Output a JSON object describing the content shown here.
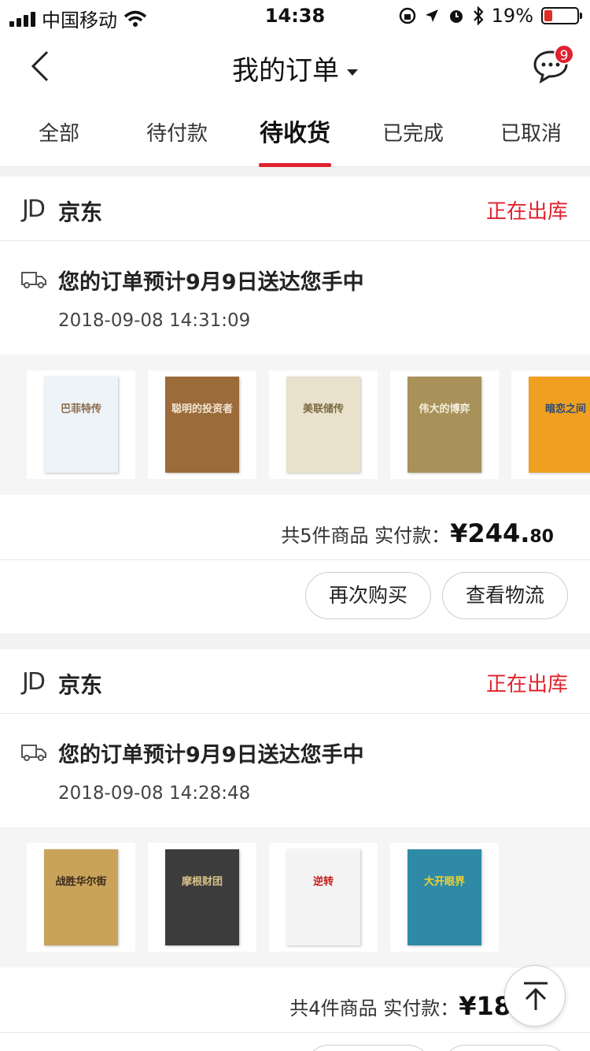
{
  "status_bar": {
    "carrier": "中国移动",
    "time": "14:38",
    "battery": "19%"
  },
  "nav": {
    "title": "我的订单",
    "message_badge": "9"
  },
  "tabs": [
    {
      "label": "全部"
    },
    {
      "label": "待付款"
    },
    {
      "label": "待收货"
    },
    {
      "label": "已完成"
    },
    {
      "label": "已取消"
    }
  ],
  "active_tab": 2,
  "orders": [
    {
      "shop_logo": "JD",
      "shop": "京东",
      "status": "正在出库",
      "delivery": "您的订单预计9月9日送达您手中",
      "time": "2018-09-08 14:31:09",
      "summary_prefix": "共5件商品  实付款：",
      "amount": "¥244.",
      "cents": "80",
      "buttons": [
        "再次购买",
        "查看物流"
      ],
      "books": [
        {
          "title": "巴菲特传",
          "color": "#eef3f8",
          "accent": "#8a6a4a"
        },
        {
          "title": "聪明的投资者",
          "color": "#9b6b3a",
          "accent": "#f1e6d2"
        },
        {
          "title": "美联储传",
          "color": "#e9e1cc",
          "accent": "#7a6a40"
        },
        {
          "title": "伟大的博弈",
          "color": "#a8925a",
          "accent": "#f5f0e0"
        },
        {
          "title": "暗恋之间",
          "color": "#f0a020",
          "accent": "#2a4a7a"
        }
      ]
    },
    {
      "shop_logo": "JD",
      "shop": "京东",
      "status": "正在出库",
      "delivery": "您的订单预计9月9日送达您手中",
      "time": "2018-09-08 14:28:48",
      "summary_prefix": "共4件商品  实付款：",
      "amount": "¥18",
      "books": [
        {
          "title": "战胜华尔街",
          "color": "#c9a35a",
          "accent": "#3a2a1a"
        },
        {
          "title": "摩根财团",
          "color": "#3c3c3c",
          "accent": "#d9c28a"
        },
        {
          "title": "逆转",
          "color": "#f4f4f4",
          "accent": "#c01a1a"
        },
        {
          "title": "大开眼界",
          "color": "#2f8aa8",
          "accent": "#f2d02a"
        }
      ]
    }
  ]
}
